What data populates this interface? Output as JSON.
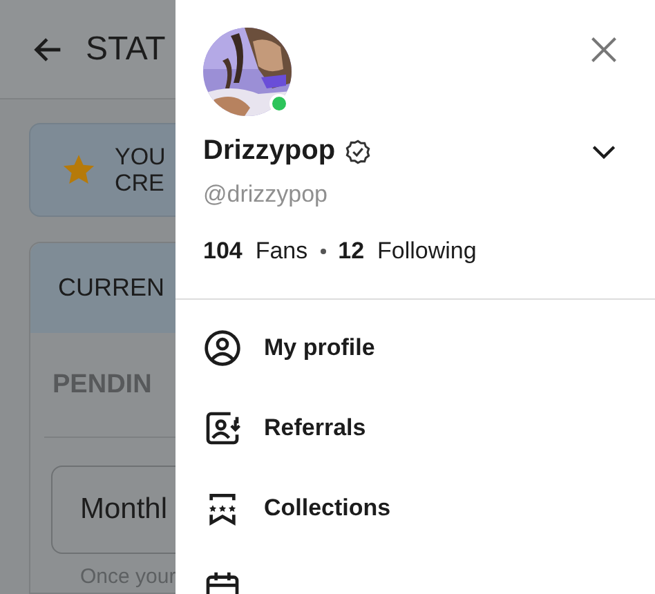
{
  "background_page": {
    "header_title": "STAT",
    "banner": {
      "lines": [
        "YOU",
        "CRE"
      ]
    },
    "card": {
      "header": "CURREN",
      "section_label": "PENDIN",
      "select_value": "Monthl",
      "note": "Once your"
    }
  },
  "drawer": {
    "user": {
      "online": true,
      "display_name": "Drizzypop",
      "verified": true,
      "handle": "@drizzypop",
      "fans_count": "104",
      "fans_label": "Fans",
      "following_count": "12",
      "following_label": "Following"
    },
    "menu": [
      {
        "kind": "profile",
        "label": "My profile"
      },
      {
        "kind": "referrals",
        "label": "Referrals"
      },
      {
        "kind": "collections",
        "label": "Collections"
      },
      {
        "kind": "calendar"
      }
    ]
  }
}
